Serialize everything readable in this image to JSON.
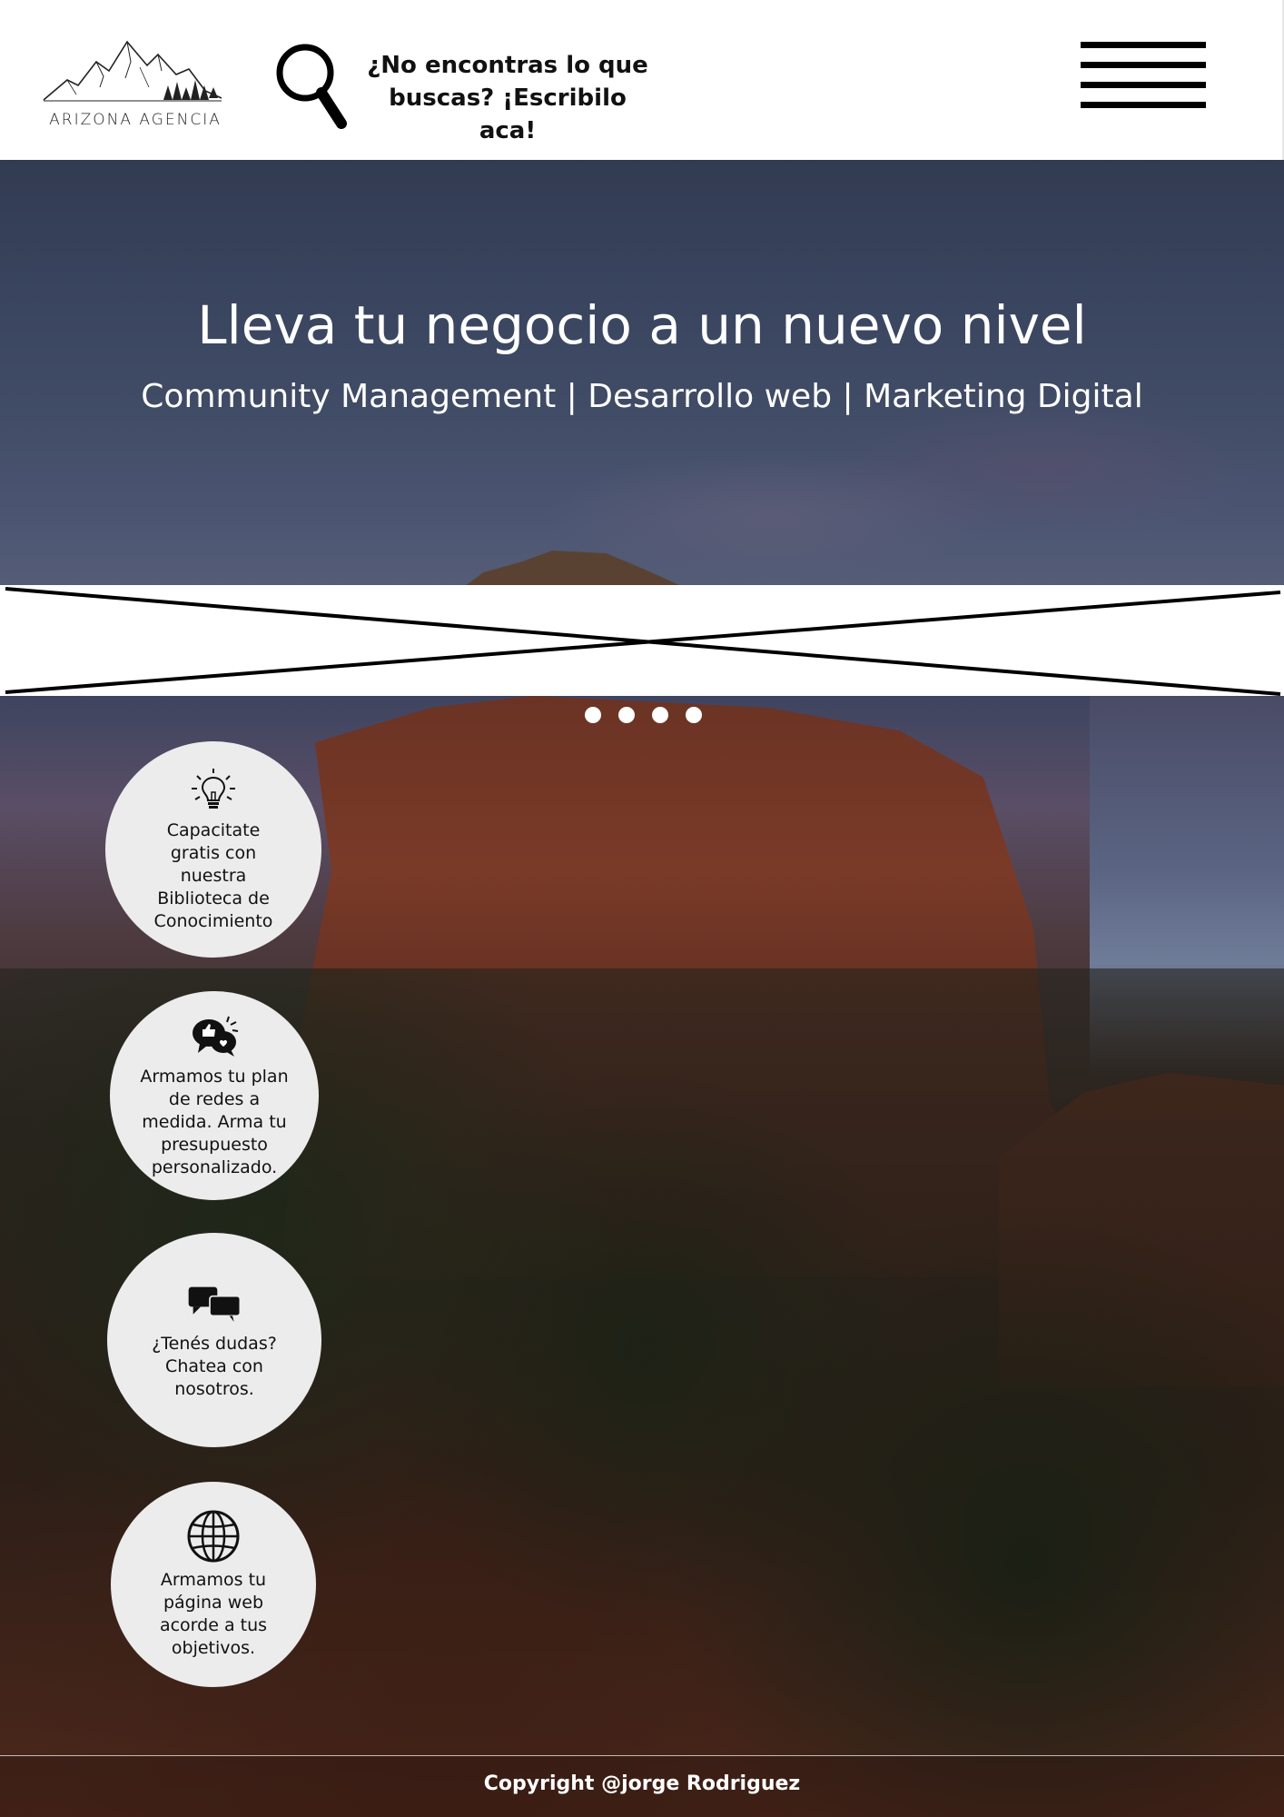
{
  "header": {
    "logo_text": "ARIZONA AGENCIA",
    "search_text": "¿No encontras lo que buscas? ¡Escribilo aca!",
    "menu_icon": "hamburger-menu-icon"
  },
  "hero": {
    "title": "Lleva tu negocio a un nuevo nivel",
    "subtitle": "Community Management | Desarrollo web | Marketing Digital"
  },
  "carousel": {
    "dots": 4
  },
  "services": [
    {
      "icon": "lightbulb-icon",
      "text": "Capacitate gratis con nuestra Biblioteca de Conocimiento"
    },
    {
      "icon": "social-likes-icon",
      "text": "Armamos tu plan de redes a medida. Arma tu presupuesto personalizado."
    },
    {
      "icon": "chat-bubbles-icon",
      "text": "¿Tenés dudas? Chatea con nosotros."
    },
    {
      "icon": "globe-icon",
      "text": "Armamos tu página web acorde a tus objetivos."
    }
  ],
  "footer": {
    "copyright": "Copyright @jorge Rodriguez"
  }
}
